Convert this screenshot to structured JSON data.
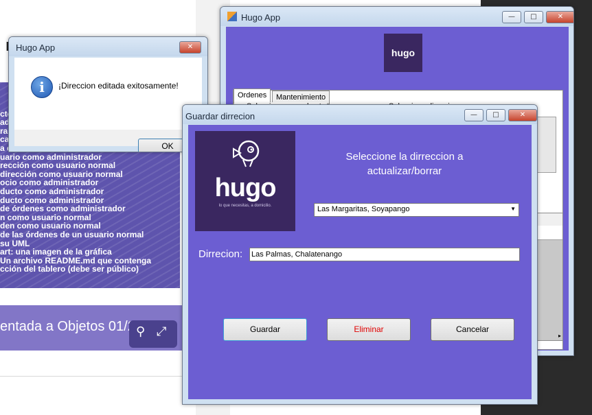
{
  "background_page": {
    "banner_lines": [
      "",
      "cto",
      "ad",
      "ra:",
      "ca e",
      "a e",
      "uario como administrador",
      "rección como usuario normal",
      "dirección como usuario normal",
      "ocio como administrador",
      "ducto como administrador",
      "ducto como administrador",
      "de órdenes como administrador",
      "n como usuario normal",
      "den como usuario normal",
      "de las órdenes de un usuario normal",
      "su UML",
      "art: una imagen de la gráfica",
      " Un  archivo  README.md  que  contenga",
      "cción del tablero (debe ser público)"
    ],
    "caption": "entada a Objetos 01/2020",
    "partial_letter": "I"
  },
  "main_window": {
    "title": "Hugo App",
    "tabs": [
      "Ordenes",
      "Mantenimiento"
    ],
    "groups": [
      "Seleccione un podructo",
      "Seleccione direccion"
    ]
  },
  "message_box": {
    "title": "Hugo App",
    "message": "¡Direccion editada exitosamente!",
    "ok_label": "OK"
  },
  "edit_window": {
    "title": "Guardar dirrecion",
    "heading": "Seleccione la dirreccion a actualizar/borrar",
    "selected_address": "Las Margaritas, Soyapango",
    "field_label": "Dirrecion:",
    "field_value": "Las Palmas, Chalatenango",
    "save_label": "Guardar",
    "delete_label": "Eliminar",
    "cancel_label": "Cancelar",
    "logo_text": "hugo",
    "logo_tagline": "lo que necesitas, a domicilio.",
    "delete_color": "#e00000"
  },
  "colors": {
    "form_purple": "#6c5ed2",
    "logo_bg": "#3a2760"
  }
}
